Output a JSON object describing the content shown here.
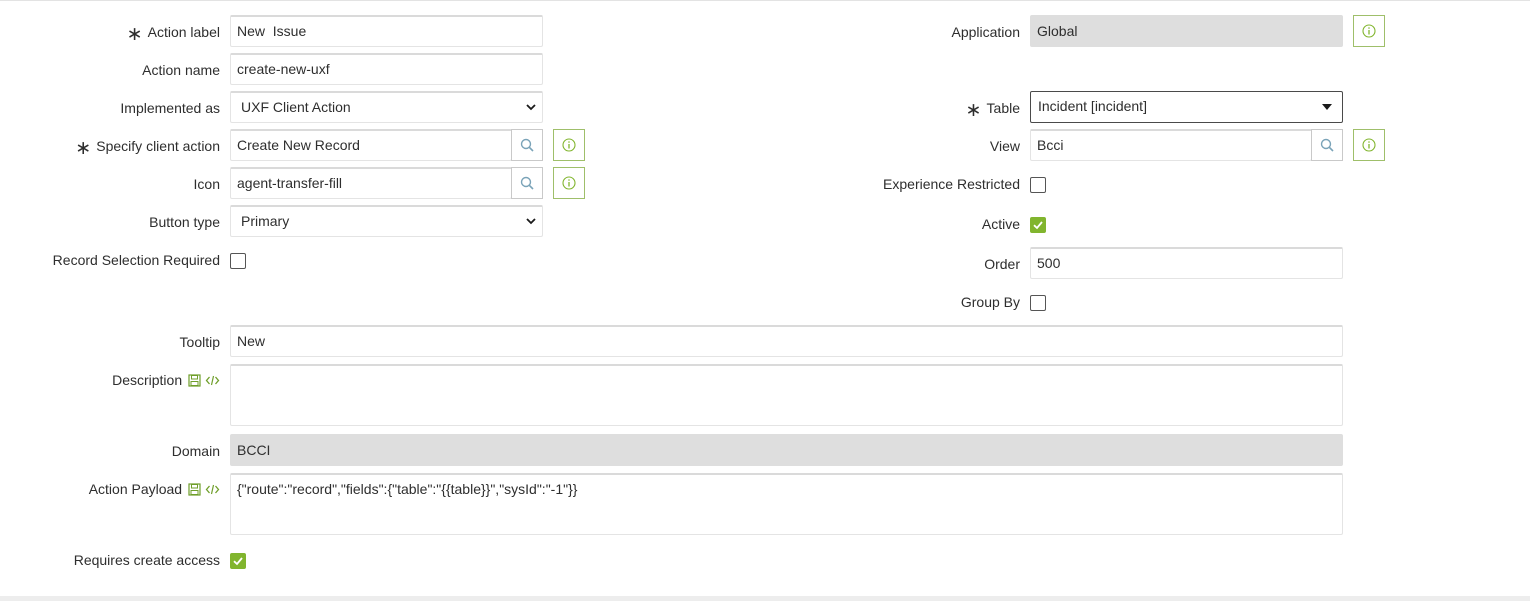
{
  "colors": {
    "accent_green": "#81b52e",
    "info_border": "#9fbf6a",
    "readonly_bg": "#dedede"
  },
  "left": {
    "action_label": {
      "label": "Action label",
      "value": "New  Issue",
      "required": true
    },
    "action_name": {
      "label": "Action name",
      "value": "create-new-uxf"
    },
    "implemented_as": {
      "label": "Implemented as",
      "value": "UXF Client Action"
    },
    "specify_client_action": {
      "label": "Specify client action",
      "value": "Create New Record",
      "required": true
    },
    "icon": {
      "label": "Icon",
      "value": "agent-transfer-fill"
    },
    "button_type": {
      "label": "Button type",
      "value": "Primary"
    },
    "record_selection_required": {
      "label": "Record Selection Required",
      "checked": false
    }
  },
  "right": {
    "application": {
      "label": "Application",
      "value": "Global"
    },
    "table": {
      "label": "Table",
      "value": "Incident [incident]",
      "required": true
    },
    "view": {
      "label": "View",
      "value": "Bcci"
    },
    "experience_restricted": {
      "label": "Experience Restricted",
      "checked": false
    },
    "active": {
      "label": "Active",
      "checked": true
    },
    "order": {
      "label": "Order",
      "value": "500"
    },
    "group_by": {
      "label": "Group By",
      "checked": false
    }
  },
  "full": {
    "tooltip": {
      "label": "Tooltip",
      "value": "New"
    },
    "description": {
      "label": "Description",
      "value": ""
    },
    "domain": {
      "label": "Domain",
      "value": "BCCI"
    },
    "action_payload": {
      "label": "Action Payload",
      "value": "{\"route\":\"record\",\"fields\":{\"table\":\"{{table}}\",\"sysId\":\"-1\"}}"
    },
    "requires_create_access": {
      "label": "Requires create access",
      "checked": true
    }
  },
  "icons": {
    "search": "search-icon",
    "info": "info-icon",
    "chevron": "chevron-down-icon",
    "save": "save-icon",
    "code": "code-icon",
    "check": "check-icon",
    "required": "required-asterisk-icon"
  }
}
